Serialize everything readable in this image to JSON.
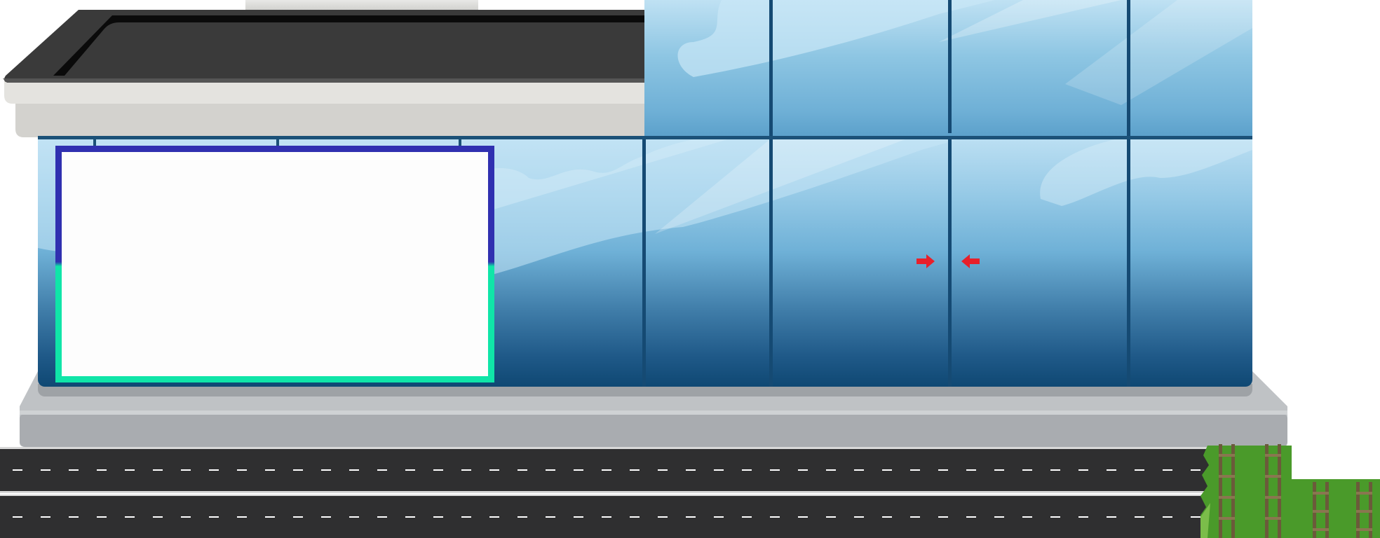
{
  "scene": {
    "background_color": "#ffffff",
    "building": {
      "roof_color": "#3a3a3a",
      "roof_trim_color": "#0a0a0a",
      "canopy_color": "#dcdbd7",
      "glass_top_color": "#bfe1f3",
      "glass_bottom_color": "#0f4873",
      "mullion_color": "#154a73",
      "plinth_color": "#bfc2c5",
      "plinth_shadow_color": "#9ea2a6"
    },
    "billboard": {
      "content": "",
      "border_top_color": "#3030b0",
      "border_bottom_color": "#10e5a8",
      "fill_color": "#fdfdfd"
    },
    "door_arrows": {
      "color": "#e8202a",
      "left_icon": "arrow-right-icon",
      "right_icon": "arrow-left-icon"
    },
    "road": {
      "lane_count": 2,
      "asphalt_color": "#2f2f30",
      "line_color": "#ffffff"
    },
    "grass": {
      "color": "#4a9a2a",
      "ladder_icon": "ladder-icon",
      "ladder_count": 4
    }
  }
}
